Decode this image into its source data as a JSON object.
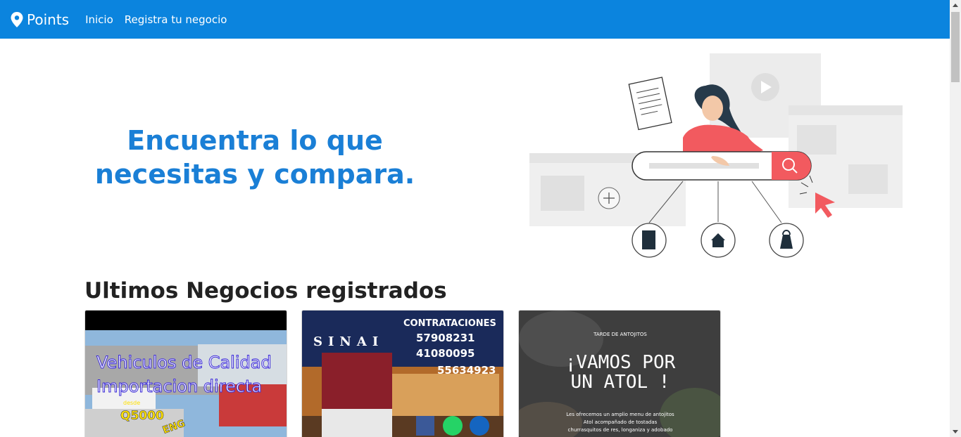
{
  "navbar": {
    "brand": "Points",
    "links": [
      "Inicio",
      "Registra tu negocio"
    ],
    "color": "#0b84de"
  },
  "hero": {
    "title": "Encuentra lo que necesitas y compara.",
    "title_color": "#1a7fd6"
  },
  "section": {
    "title": "Ultimos Negocios registrados"
  },
  "cards": [
    {
      "line1": "Vehiculos de Calidad",
      "line2": "Importacion directa",
      "price_label": "desde",
      "price": "Q5000",
      "stamp": "ENG"
    },
    {
      "heading": "CONTRATACIONES",
      "name": "SINAI",
      "phones": [
        "57908231",
        "41080095",
        "55634923"
      ]
    },
    {
      "kicker": "TARDE DE ANTOJITOS",
      "headline1": "¡VAMOS POR",
      "headline2": "UN ATOL !",
      "desc1": "Les ofrecemos un amplio menu de antojitos",
      "desc2": "Atol acompañado de tostadas",
      "desc3": "churrasquitos de res, longaniza y adobado"
    }
  ]
}
